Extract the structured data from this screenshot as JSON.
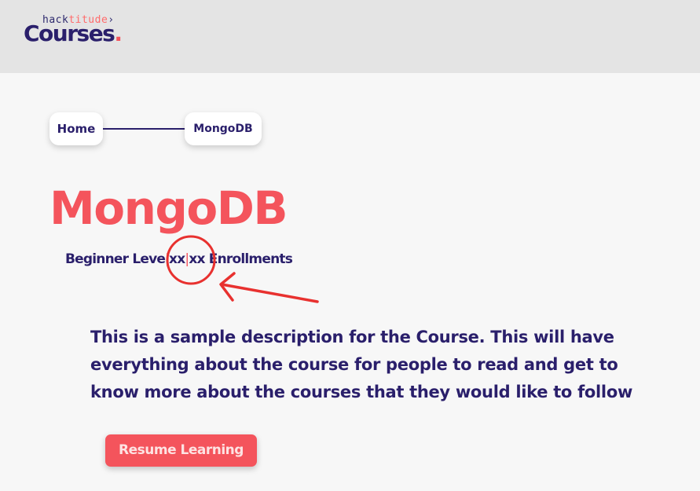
{
  "header": {
    "logo": {
      "top_prefix": "hack",
      "top_accent": "titude",
      "top_suffix": "›",
      "main": "Courses",
      "dot": "."
    }
  },
  "breadcrumb": {
    "items": [
      {
        "label": "Home"
      },
      {
        "label": "MongoDB"
      }
    ]
  },
  "course": {
    "title": "MongoDB",
    "meta": {
      "level": "Beginner Leve",
      "separator": "|",
      "value": "xx",
      "enrollments_prefix": "xx",
      "enrollments_label": " Enrollments"
    },
    "description": "This is a sample description for the Course. This will have everything about the course for people to read and get to know more about the courses that they would like to follow",
    "resume_button": "Resume Learning"
  },
  "colors": {
    "brand_navy": "#2a1f6b",
    "accent_red": "#f4545c",
    "annotation_red": "#e8312f",
    "header_bg": "#e4e4e4",
    "page_bg": "#f7f7f7"
  },
  "icons": {
    "annotation": [
      "circle-highlight-icon",
      "arrow-annotation-icon"
    ]
  }
}
